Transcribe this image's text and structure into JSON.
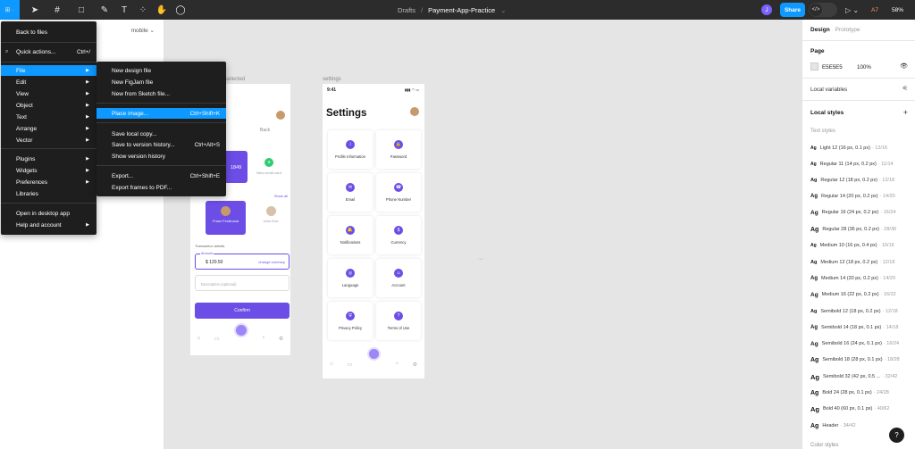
{
  "toolbar": {
    "main_icon": "figma-menu-icon",
    "breadcrumb_drafts": "Drafts",
    "breadcrumb_sep": "/",
    "project_name": "Payment-App-Practice",
    "project_caret": "⌄",
    "avatar_initial": "J",
    "share_label": "Share",
    "a7_label": "A7",
    "zoom_label": "58%",
    "accent": "#0d99ff"
  },
  "left_panel": {
    "page_selector": "mobile ⌄"
  },
  "canvas": {
    "frame_settings_label": "settings",
    "frame_mobile_label": "selected",
    "settings": {
      "time": "9:41",
      "title": "Settings",
      "cards": [
        {
          "label": "Profile Information",
          "icon": "i"
        },
        {
          "label": "Password",
          "icon": "🔒"
        },
        {
          "label": "Email",
          "icon": "✉"
        },
        {
          "label": "Phone Number",
          "icon": "☎"
        },
        {
          "label": "Notifications",
          "icon": "🔔"
        },
        {
          "label": "Currency",
          "icon": "$"
        },
        {
          "label": "Language",
          "icon": "◎"
        },
        {
          "label": "Account",
          "icon": "☺"
        },
        {
          "label": "Privacy Policy",
          "icon": "⛨"
        },
        {
          "label": "Terms of Use",
          "icon": "?"
        }
      ]
    },
    "mobile": {
      "back_label": "Back",
      "card_number": "1849",
      "new_card_label": "New credit card",
      "show_all": "Show all",
      "friend1": "Franz Ferdinand",
      "friend2": "John Doe",
      "transaction_details": "Transaction details",
      "amount_label": "Amount",
      "amount_value": "$ 120.50",
      "change_currency": "change currency",
      "description_placeholder": "Description (optional)",
      "confirm_label": "Confirm"
    },
    "ellipsis": "···"
  },
  "main_menu": {
    "items": [
      {
        "label": "Back to files"
      },
      {
        "label": "Quick actions...",
        "shortcut": "Ctrl+/"
      },
      {
        "label": "File",
        "arrow": "▶"
      },
      {
        "label": "Edit",
        "arrow": "▶"
      },
      {
        "label": "View",
        "arrow": "▶"
      },
      {
        "label": "Object",
        "arrow": "▶"
      },
      {
        "label": "Text",
        "arrow": "▶"
      },
      {
        "label": "Arrange",
        "arrow": "▶"
      },
      {
        "label": "Vector",
        "arrow": "▶"
      },
      {
        "label": "Plugins",
        "arrow": "▶"
      },
      {
        "label": "Widgets",
        "arrow": "▶"
      },
      {
        "label": "Preferences",
        "arrow": "▶"
      },
      {
        "label": "Libraries"
      },
      {
        "label": "Open in desktop app"
      },
      {
        "label": "Help and account",
        "arrow": "▶"
      }
    ]
  },
  "file_menu": {
    "items": [
      {
        "label": "New design file"
      },
      {
        "label": "New FigJam file"
      },
      {
        "label": "New from Sketch file..."
      },
      {
        "label": "Place image...",
        "shortcut": "Ctrl+Shift+K"
      },
      {
        "label": "Save local copy..."
      },
      {
        "label": "Save to version history...",
        "shortcut": "Ctrl+Alt+S"
      },
      {
        "label": "Show version history"
      },
      {
        "label": "Export...",
        "shortcut": "Ctrl+Shift+E"
      },
      {
        "label": "Export frames to PDF..."
      }
    ]
  },
  "right_panel": {
    "tab_design": "Design",
    "tab_prototype": "Prototype",
    "page_heading": "Page",
    "page_color": "E5E5E5",
    "page_opacity": "100%",
    "local_variables": "Local variables",
    "local_styles": "Local styles",
    "text_styles_heading": "Text styles",
    "text_styles": [
      {
        "name": "Light 12 (16 px, 0.1 px)",
        "meta": "· 12/16"
      },
      {
        "name": "Regular 11 (14 px, 0.2 px)",
        "meta": "· 11/14"
      },
      {
        "name": "Regular 12 (18 px, 0.2 px)",
        "meta": "· 12/18"
      },
      {
        "name": "Regular 14 (20 px, 0.2 px)",
        "meta": "· 14/20"
      },
      {
        "name": "Regular 16 (24 px, 0.2 px)",
        "meta": "· 16/24"
      },
      {
        "name": "Regular 28 (36 px, 0.2 px)",
        "meta": "· 28/36"
      },
      {
        "name": "Medium 10 (16 px, 0.4 px)",
        "meta": "· 10/16"
      },
      {
        "name": "Medium 12 (18 px, 0.2 px)",
        "meta": "· 12/18"
      },
      {
        "name": "Medium 14 (20 px, 0.2 px)",
        "meta": "· 14/20"
      },
      {
        "name": "Medium 16 (22 px, 0.2 px)",
        "meta": "· 16/22"
      },
      {
        "name": "Semibold 12 (18 px, 0.2 px)",
        "meta": "· 12/18"
      },
      {
        "name": "Semibold 14 (18 px, 0.1 px)",
        "meta": "· 14/18"
      },
      {
        "name": "Semibold 16 (24 px, 0.1 px)",
        "meta": "· 16/24"
      },
      {
        "name": "Semibold 18 (28 px, 0.1 px)",
        "meta": "· 18/28"
      },
      {
        "name": "Semibold 32 (42 px, 0.5 ...",
        "meta": "· 32/42"
      },
      {
        "name": "Bold 24 (28 px, 0.1 px)",
        "meta": "· 24/28"
      },
      {
        "name": "Bold 40 (60 px, 0.1 px)",
        "meta": "· 40/62"
      },
      {
        "name": "Header",
        "meta": "· 34/42"
      }
    ],
    "color_styles_heading": "Color styles",
    "help_label": "?"
  }
}
